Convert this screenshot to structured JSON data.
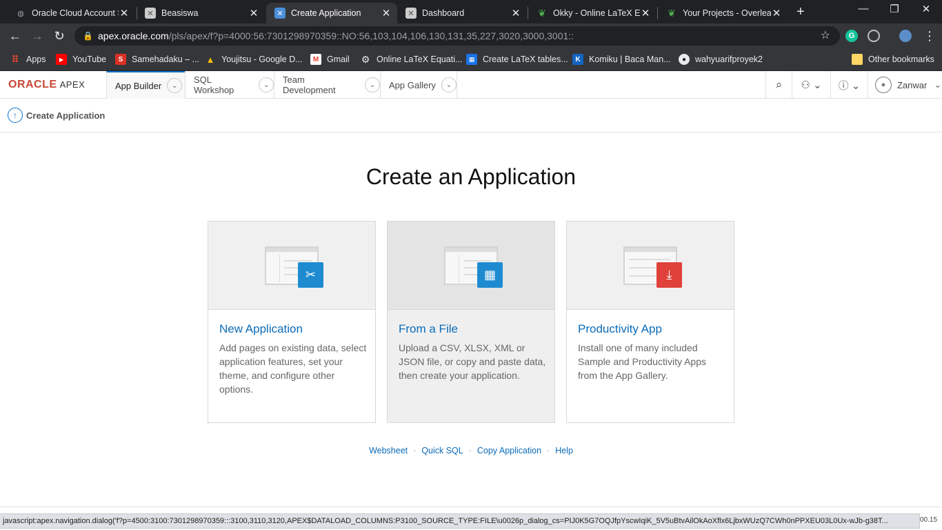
{
  "browser": {
    "tabs": [
      {
        "title": "Oracle Cloud Account S",
        "favicon": "globe-icon",
        "active": false
      },
      {
        "title": "Beasiswa",
        "favicon": "apex-icon",
        "active": false
      },
      {
        "title": "Create Application",
        "favicon": "apex-icon",
        "active": true
      },
      {
        "title": "Dashboard",
        "favicon": "apex-icon",
        "active": false
      },
      {
        "title": "Okky - Online LaTeX Ed",
        "favicon": "overleaf-icon",
        "active": false
      },
      {
        "title": "Your Projects - Overleaf",
        "favicon": "overleaf-icon",
        "active": false
      }
    ],
    "url_host": "apex.oracle.com",
    "url_path": "/pls/apex/f?p=4000:56:7301298970359::NO:56,103,104,106,130,131,35,227,3020,3000,3001::",
    "bookmarks": [
      {
        "label": "Apps",
        "icon": "apps-grid-icon"
      },
      {
        "label": "YouTube",
        "icon": "youtube-icon"
      },
      {
        "label": "Samehadaku – ...",
        "icon": "samehadaku-icon"
      },
      {
        "label": "Youjitsu - Google D...",
        "icon": "google-drive-icon"
      },
      {
        "label": "Gmail",
        "icon": "gmail-icon"
      },
      {
        "label": "Online LaTeX Equati...",
        "icon": "gear-icon"
      },
      {
        "label": "Create LaTeX tables...",
        "icon": "table-icon"
      },
      {
        "label": "Komiku | Baca Man...",
        "icon": "komiku-icon"
      },
      {
        "label": "wahyuarifproyek2",
        "icon": "github-icon"
      }
    ],
    "other_bookmarks": "Other bookmarks"
  },
  "apex": {
    "logo_oracle": "ORACLE",
    "logo_apex": "APEX",
    "nav": [
      {
        "label": "App Builder",
        "active": true
      },
      {
        "label": "SQL Workshop",
        "active": false
      },
      {
        "label": "Team Development",
        "active": false
      },
      {
        "label": "App Gallery",
        "active": false
      }
    ],
    "user_name": "Zanwar"
  },
  "breadcrumb": {
    "label": "Create Application"
  },
  "main": {
    "title": "Create an Application",
    "cards": [
      {
        "title": "New Application",
        "description": "Add pages on existing data, select application features, set your theme, and configure other options.",
        "icon": "wrench-ruler-icon",
        "color": "#1e8bd1"
      },
      {
        "title": "From a File",
        "description": "Upload a CSV, XLSX, XML or JSON file, or copy and paste data, then create your application.",
        "icon": "table-grid-icon",
        "color": "#1e8bd1"
      },
      {
        "title": "Productivity App",
        "description": "Install one of many included Sample and Productivity Apps from the App Gallery.",
        "icon": "download-icon",
        "color": "#e0413a"
      }
    ],
    "links": [
      "Websheet",
      "Quick SQL",
      "Copy Application",
      "Help"
    ]
  },
  "status": {
    "url": "javascript:apex.navigation.dialog('f?p=4500:3100:7301298970359:::3100,3110,3120,APEX$DATALOAD_COLUMNS:P3100_SOURCE_TYPE:FILE\\u0026p_dialog_cs=PIJ0K5G7OQJfpYscwIqiK_5V5uBtvAilOkAoXflx6LjbxWUzQ7CWh0nPPXEU03L0Ux-wJb-g38T...",
    "clock": "00.15"
  }
}
